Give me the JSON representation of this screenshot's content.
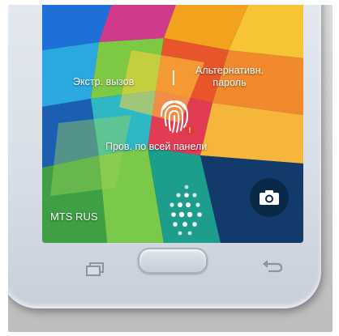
{
  "lockscreen": {
    "emergency_call": "Экстр. вызов",
    "alt_password_line1": "Альтернативн.",
    "alt_password_line2": "пароль",
    "swipe_prompt": "Пров. по всей панели",
    "carrier": "MTS RUS",
    "alert_mark": "!"
  },
  "icons": {
    "fingerprint": "fingerprint-icon",
    "camera": "camera-icon",
    "recent_apps": "recent-apps-icon",
    "back": "back-icon",
    "unlock": "unlock-dots-icon"
  },
  "colors": {
    "camera_button": "#0a2846",
    "alert": "#e53935",
    "phone_frame": "#dde3eb"
  }
}
